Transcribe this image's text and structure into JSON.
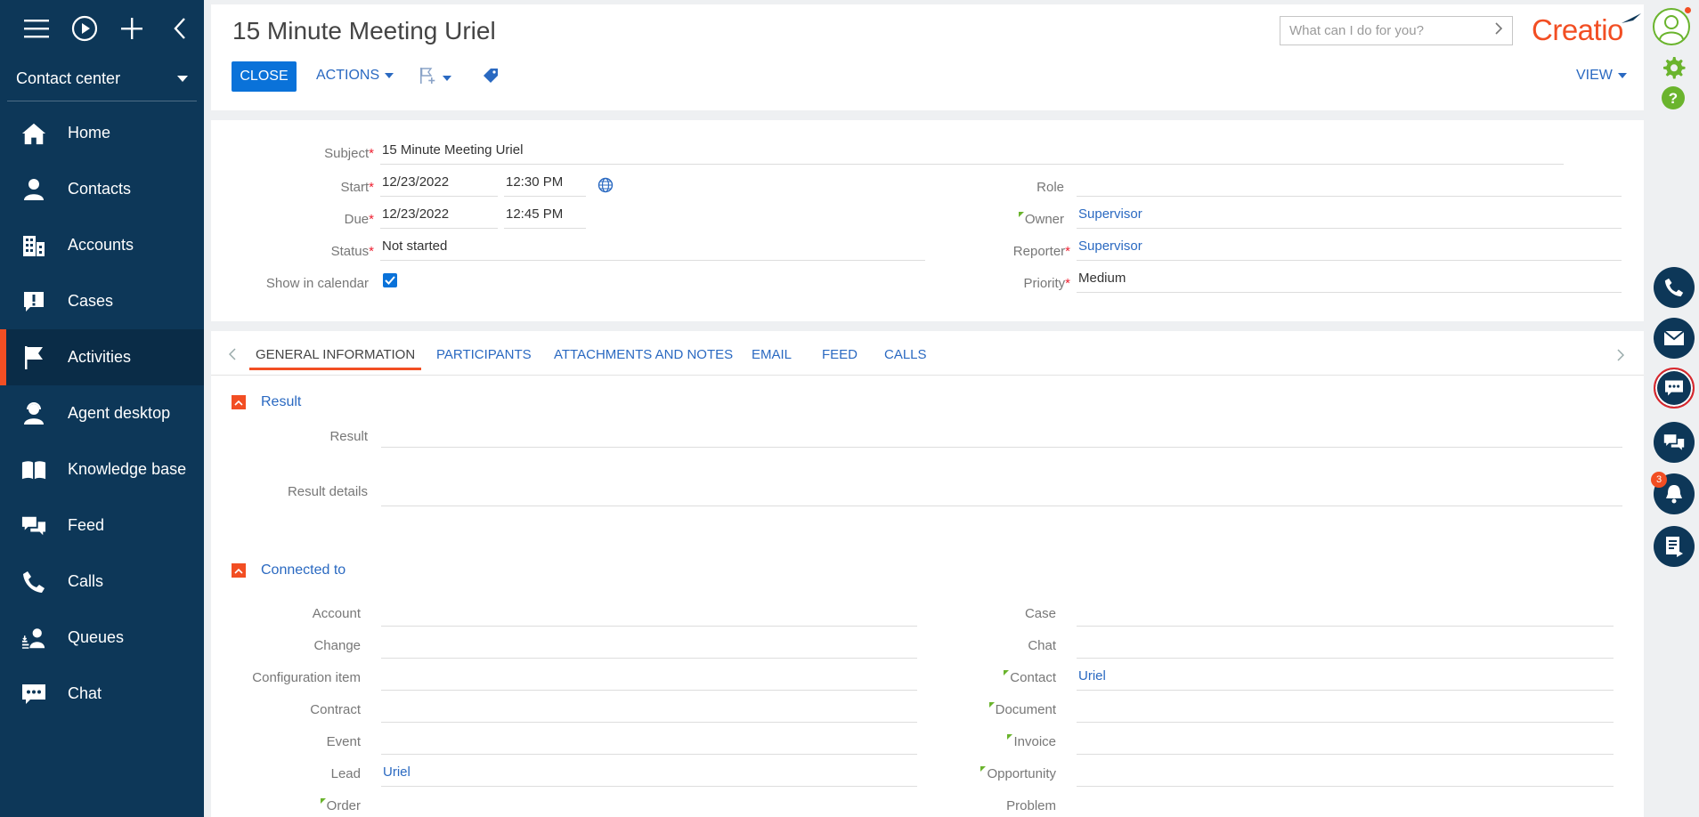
{
  "sidebar": {
    "workspace": "Contact center",
    "items": [
      {
        "label": "Home",
        "icon": "home-icon"
      },
      {
        "label": "Contacts",
        "icon": "person-icon"
      },
      {
        "label": "Accounts",
        "icon": "building-icon"
      },
      {
        "label": "Cases",
        "icon": "exclamation-icon"
      },
      {
        "label": "Activities",
        "icon": "flag-icon",
        "active": true
      },
      {
        "label": "Agent desktop",
        "icon": "agent-icon"
      },
      {
        "label": "Knowledge base",
        "icon": "book-icon"
      },
      {
        "label": "Feed",
        "icon": "chat-bubbles-icon"
      },
      {
        "label": "Calls",
        "icon": "phone-icon"
      },
      {
        "label": "Queues",
        "icon": "queue-icon"
      },
      {
        "label": "Chat",
        "icon": "chat-icon"
      }
    ]
  },
  "header": {
    "title": "15 Minute Meeting Uriel",
    "close_label": "CLOSE",
    "actions_label": "ACTIONS",
    "view_label": "VIEW",
    "search_placeholder": "What can I do for you?",
    "logo": "Creatio"
  },
  "fields": {
    "subject": {
      "label": "Subject",
      "value": "15 Minute Meeting Uriel"
    },
    "start": {
      "label": "Start",
      "date": "12/23/2022",
      "time": "12:30 PM"
    },
    "due": {
      "label": "Due",
      "date": "12/23/2022",
      "time": "12:45 PM"
    },
    "status": {
      "label": "Status",
      "value": "Not started"
    },
    "show_in_calendar": {
      "label": "Show in calendar",
      "checked": true
    },
    "role": {
      "label": "Role",
      "value": ""
    },
    "owner": {
      "label": "Owner",
      "value": "Supervisor"
    },
    "reporter": {
      "label": "Reporter",
      "value": "Supervisor"
    },
    "priority": {
      "label": "Priority",
      "value": "Medium"
    }
  },
  "tabs": [
    {
      "label": "GENERAL INFORMATION",
      "active": true
    },
    {
      "label": "PARTICIPANTS"
    },
    {
      "label": "ATTACHMENTS AND NOTES"
    },
    {
      "label": "EMAIL"
    },
    {
      "label": "FEED"
    },
    {
      "label": "CALLS"
    }
  ],
  "result_group": {
    "title": "Result",
    "result_label": "Result",
    "details_label": "Result details"
  },
  "connected_group": {
    "title": "Connected to",
    "left": [
      {
        "label": "Account",
        "value": ""
      },
      {
        "label": "Change",
        "value": ""
      },
      {
        "label": "Configuration item",
        "value": ""
      },
      {
        "label": "Contract",
        "value": ""
      },
      {
        "label": "Event",
        "value": ""
      },
      {
        "label": "Lead",
        "value": "Uriel"
      },
      {
        "label": "Order",
        "value": ""
      }
    ],
    "right": [
      {
        "label": "Case",
        "value": ""
      },
      {
        "label": "Chat",
        "value": ""
      },
      {
        "label": "Contact",
        "value": "Uriel"
      },
      {
        "label": "Document",
        "value": ""
      },
      {
        "label": "Invoice",
        "value": ""
      },
      {
        "label": "Opportunity",
        "value": ""
      },
      {
        "label": "Problem",
        "value": ""
      }
    ]
  },
  "rightbar": {
    "notification_count": "3"
  },
  "colors": {
    "sidebar": "#0d3758",
    "accent": "#f24e23",
    "link": "#2a69c1",
    "primary_button": "#0a72d9"
  }
}
